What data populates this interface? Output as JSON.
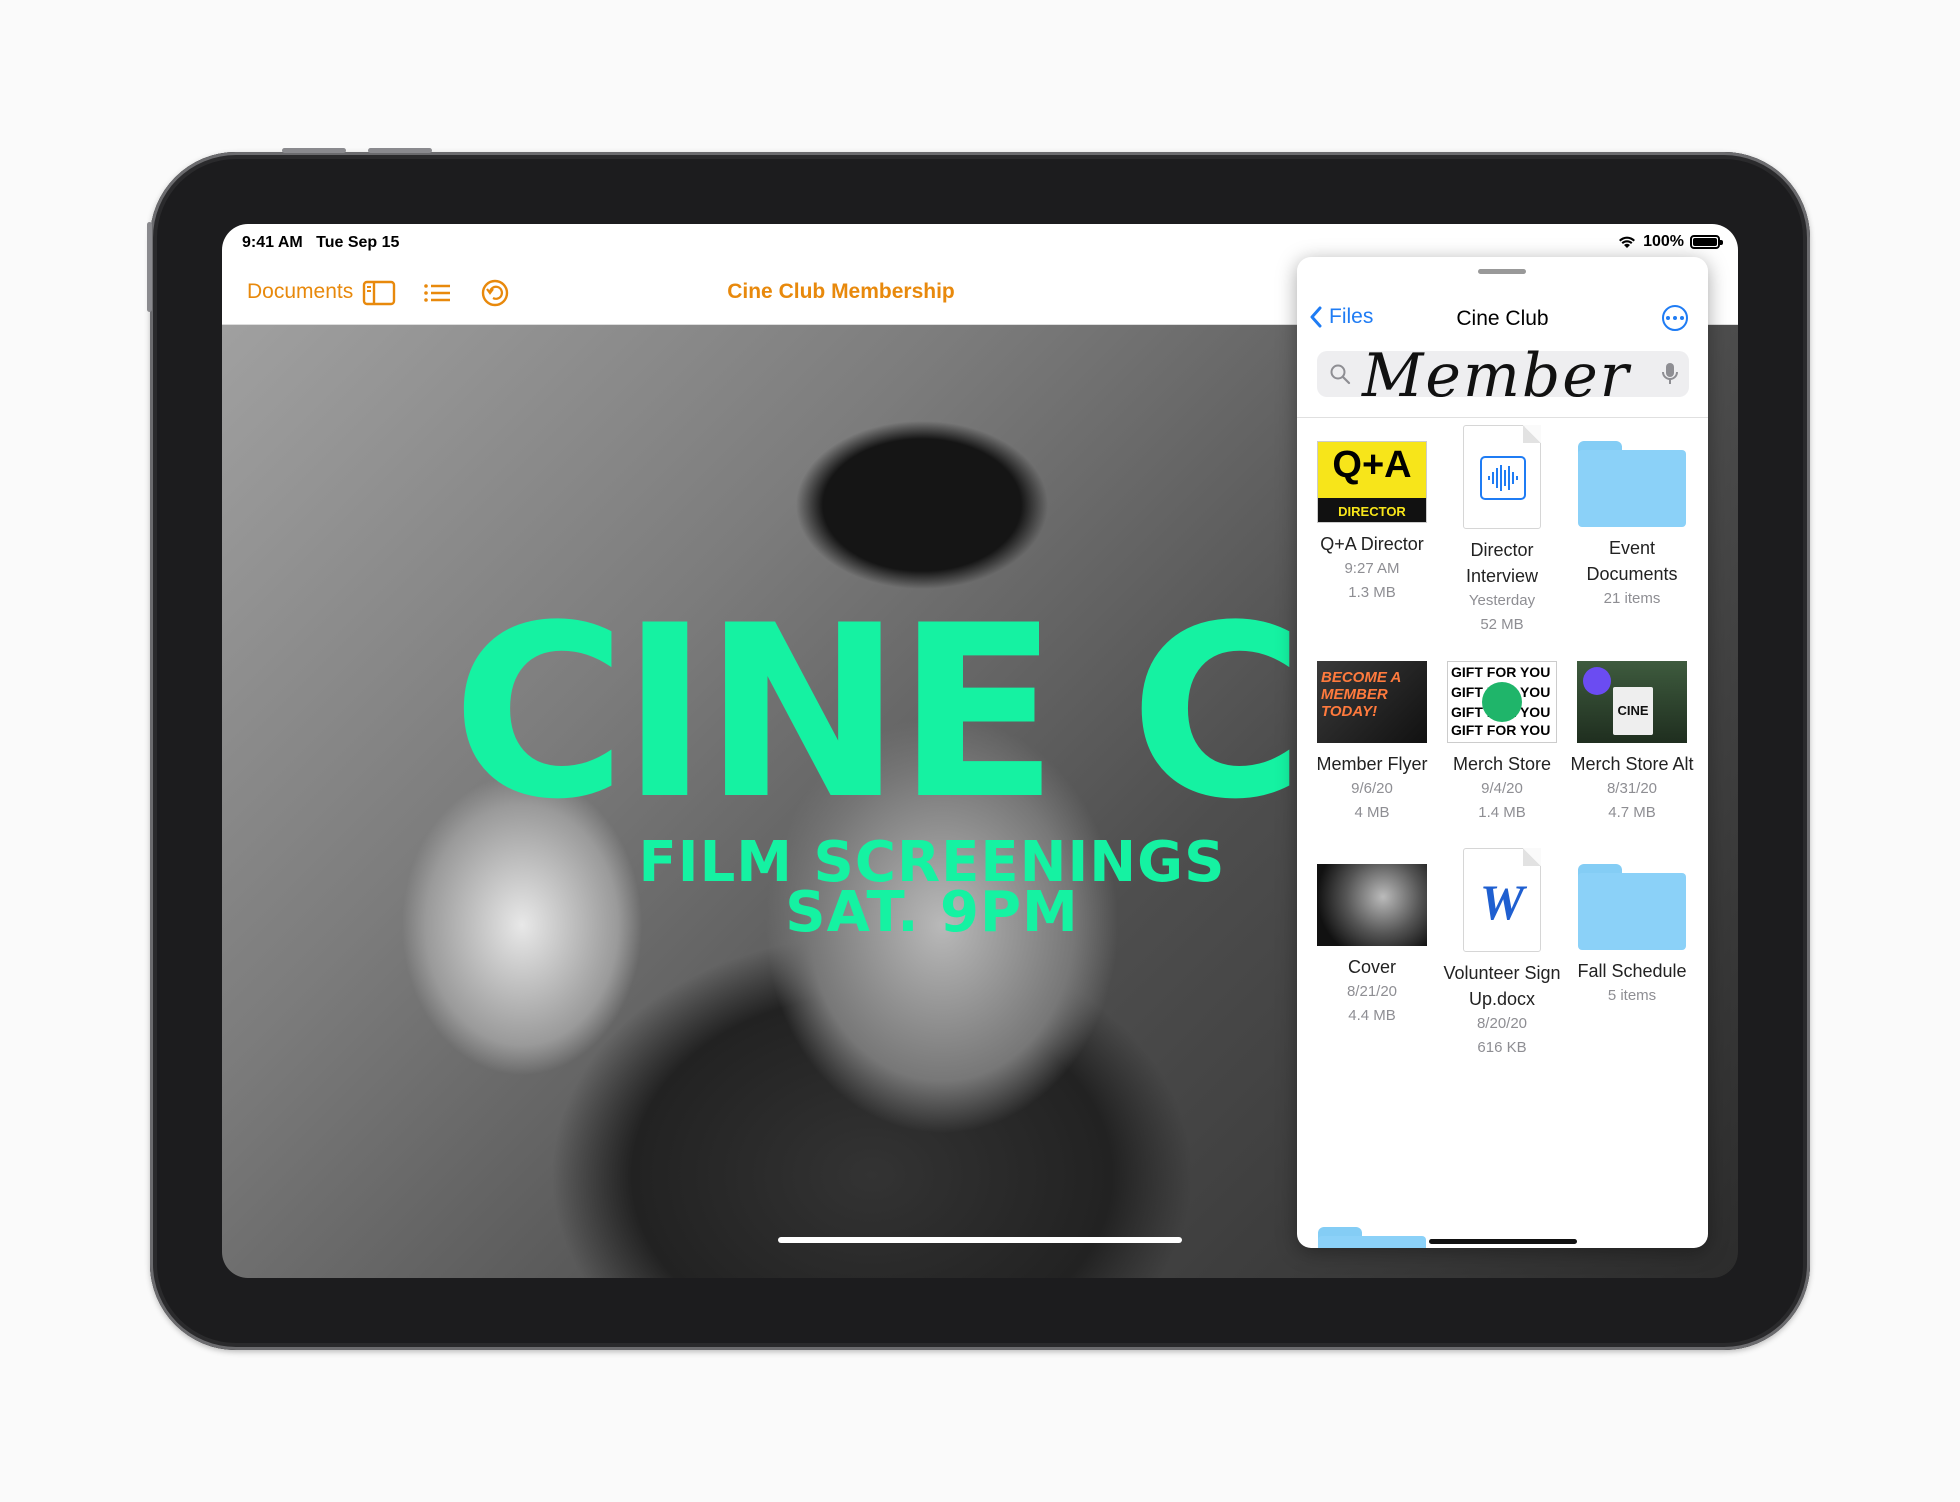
{
  "status": {
    "time": "9:41 AM",
    "date": "Tue Sep 15",
    "battery": "100%"
  },
  "toolbar": {
    "documents": "Documents",
    "title": "Cine Club Membership"
  },
  "poster": {
    "title": "CINE CLU",
    "line1": "FILM SCREENINGS",
    "line2": "SAT. 9PM"
  },
  "files": {
    "back": "Files",
    "title": "Cine Club",
    "search_value": "Member",
    "items": [
      {
        "name": "Q+A Director",
        "meta1": "9:27 AM",
        "meta2": "1.3 MB",
        "thumb_text": "Q+A",
        "thumb_sub": "DIRECTOR"
      },
      {
        "name": "Director Interview",
        "meta1": "Yesterday",
        "meta2": "52 MB"
      },
      {
        "name": "Event Documents",
        "meta1": "21 items",
        "meta2": ""
      },
      {
        "name": "Member Flyer",
        "meta1": "9/6/20",
        "meta2": "4 MB",
        "thumb_text": "BECOME A MEMBER TODAY!"
      },
      {
        "name": "Merch Store",
        "meta1": "9/4/20",
        "meta2": "1.4 MB",
        "thumb_text": "GIFT FOR YOU"
      },
      {
        "name": "Merch Store Alt",
        "meta1": "8/31/20",
        "meta2": "4.7 MB",
        "thumb_text": "CINE"
      },
      {
        "name": "Cover",
        "meta1": "8/21/20",
        "meta2": "4.4 MB"
      },
      {
        "name": "Volunteer Sign Up.docx",
        "meta1": "8/20/20",
        "meta2": "616 KB",
        "thumb_text": "W"
      },
      {
        "name": "Fall Schedule",
        "meta1": "5 items",
        "meta2": ""
      }
    ]
  },
  "colors": {
    "accent": "#e8890c",
    "link": "#1f7cf4",
    "poster": "#15f2a2"
  }
}
